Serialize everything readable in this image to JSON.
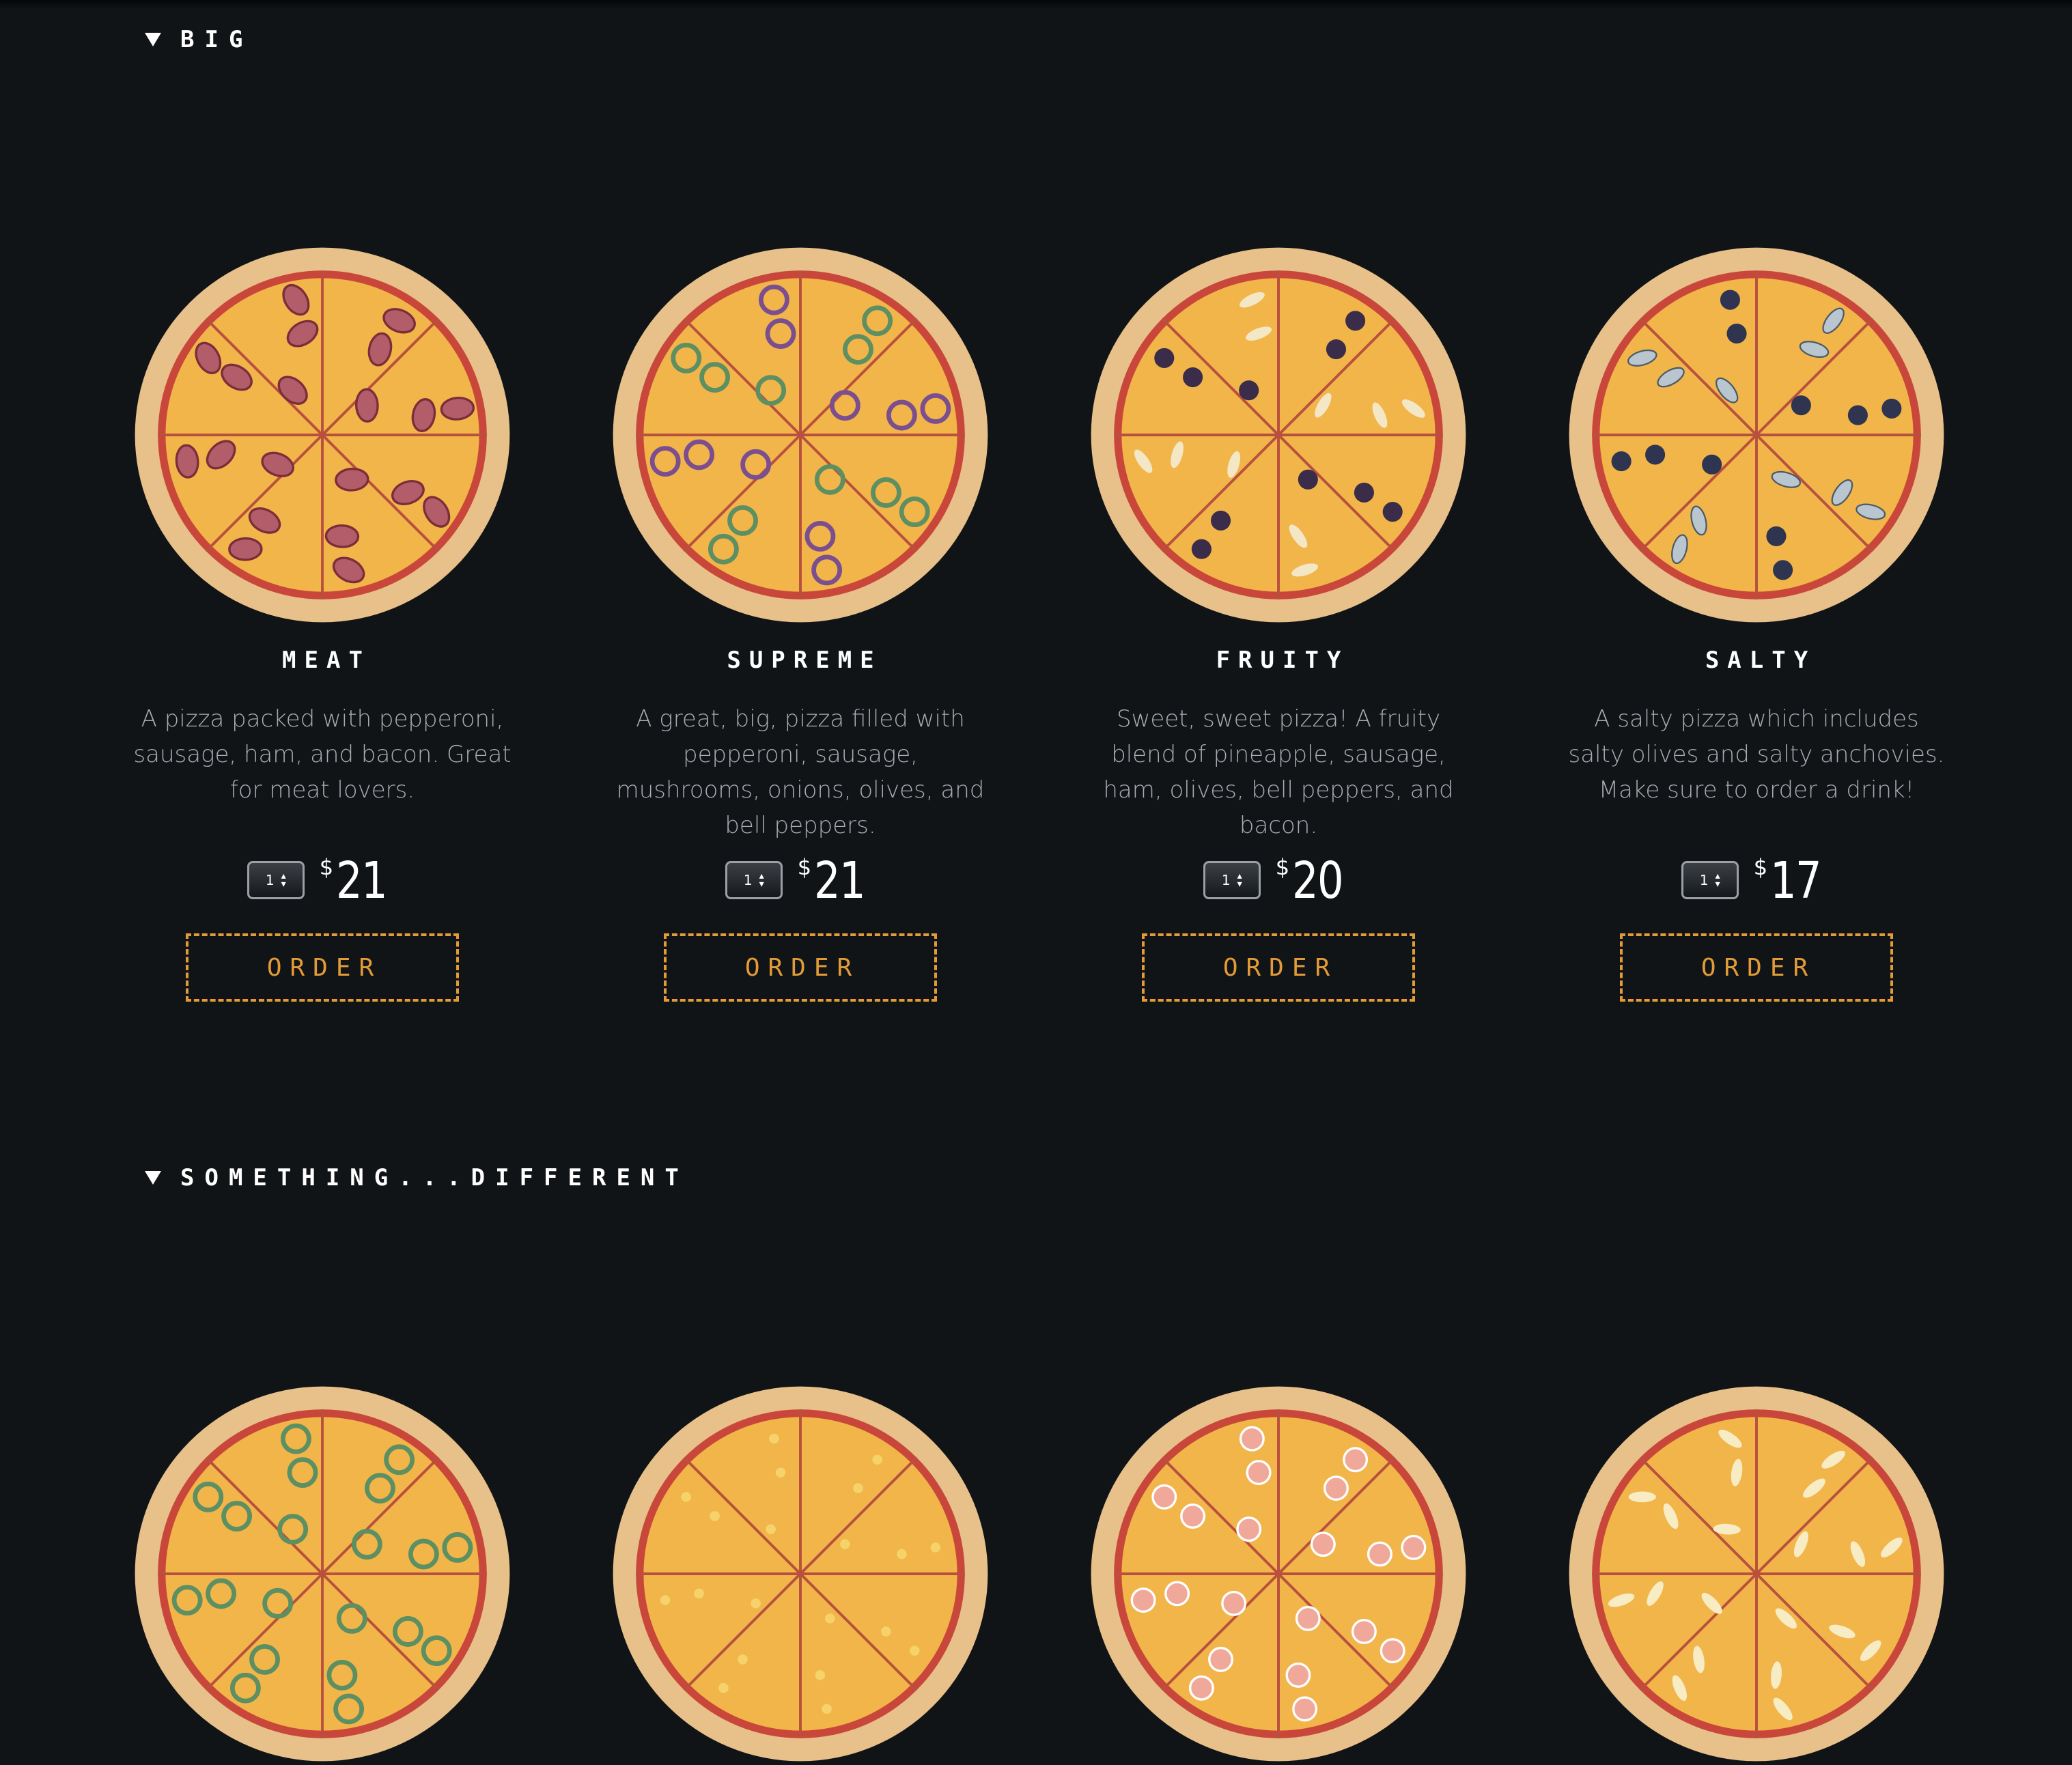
{
  "sections": [
    {
      "title": "BIG",
      "items": [
        {
          "name": "MEAT",
          "description": "A pizza packed with pepperoni, sausage, ham, and bacon. Great for meat lovers.",
          "currency": "$",
          "price": "21",
          "qty": "1",
          "order_label": "ORDER",
          "image_icon": "meat-pizza-icon"
        },
        {
          "name": "SUPREME",
          "description": "A great, big, pizza filled with pepperoni, sausage, mushrooms, onions, olives, and bell peppers.",
          "currency": "$",
          "price": "21",
          "qty": "1",
          "order_label": "ORDER",
          "image_icon": "supreme-pizza-icon"
        },
        {
          "name": "FRUITY",
          "description": "Sweet, sweet pizza! A fruity blend of pineapple, sausage, ham, olives, bell peppers, and bacon.",
          "currency": "$",
          "price": "20",
          "qty": "1",
          "order_label": "ORDER",
          "image_icon": "fruity-pizza-icon"
        },
        {
          "name": "SALTY",
          "description": "A salty pizza which includes salty olives and salty anchovies. Make sure to order a drink!",
          "currency": "$",
          "price": "17",
          "qty": "1",
          "order_label": "ORDER",
          "image_icon": "salty-pizza-icon"
        }
      ]
    },
    {
      "title": "SOMETHING...DIFFERENT",
      "items": [
        {
          "image_icon": "pepper-pizza-icon"
        },
        {
          "image_icon": "corn-pizza-icon"
        },
        {
          "image_icon": "shrimp-pizza-icon"
        },
        {
          "image_icon": "cheese-pizza-icon"
        }
      ]
    }
  ],
  "colors": {
    "background": "#111417",
    "accent": "#e39b37",
    "crust": "#e7c08a",
    "sauce": "#c9473a",
    "cheese": "#f1b54a"
  }
}
